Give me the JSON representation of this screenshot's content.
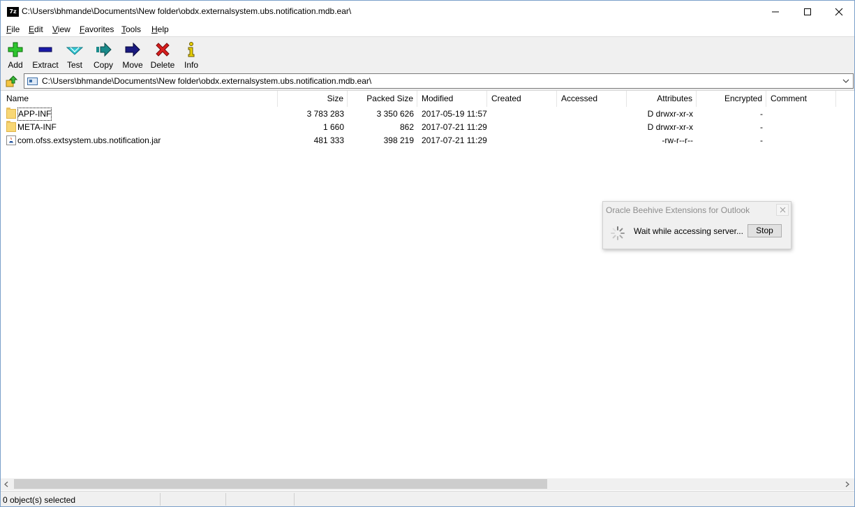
{
  "window": {
    "title": "C:\\Users\\bhmande\\Documents\\New folder\\obdx.externalsystem.ubs.notification.mdb.ear\\",
    "app_icon": "7z"
  },
  "menu": [
    {
      "label": "File",
      "key": "F",
      "rest": "ile"
    },
    {
      "label": "Edit",
      "key": "E",
      "rest": "dit"
    },
    {
      "label": "View",
      "key": "V",
      "rest": "iew"
    },
    {
      "label": "Favorites",
      "key": "F",
      "rest": "avorites"
    },
    {
      "label": "Tools",
      "key": "T",
      "rest": "ools"
    },
    {
      "label": "Help",
      "key": "H",
      "rest": "elp"
    }
  ],
  "toolbar": {
    "add": "Add",
    "extract": "Extract",
    "test": "Test",
    "copy": "Copy",
    "move": "Move",
    "delete": "Delete",
    "info": "Info"
  },
  "address": {
    "path": "C:\\Users\\bhmande\\Documents\\New folder\\obdx.externalsystem.ubs.notification.mdb.ear\\"
  },
  "columns": {
    "name": "Name",
    "size": "Size",
    "packed_size": "Packed Size",
    "modified": "Modified",
    "created": "Created",
    "accessed": "Accessed",
    "attributes": "Attributes",
    "encrypted": "Encrypted",
    "comment": "Comment"
  },
  "files": [
    {
      "name": "APP-INF",
      "type": "folder",
      "size": "3 783 283",
      "packed_size": "3 350 626",
      "modified": "2017-05-19 11:57",
      "created": "",
      "accessed": "",
      "attributes": "D drwxr-xr-x",
      "encrypted": "-",
      "comment": ""
    },
    {
      "name": "META-INF",
      "type": "folder",
      "size": "1 660",
      "packed_size": "862",
      "modified": "2017-07-21 11:29",
      "created": "",
      "accessed": "",
      "attributes": "D drwxr-xr-x",
      "encrypted": "-",
      "comment": ""
    },
    {
      "name": "com.ofss.extsystem.ubs.notification.jar",
      "type": "jar",
      "size": "481 333",
      "packed_size": "398 219",
      "modified": "2017-07-21 11:29",
      "created": "",
      "accessed": "",
      "attributes": "-rw-r--r--",
      "encrypted": "-",
      "comment": ""
    }
  ],
  "status": {
    "selection": "0 object(s) selected"
  },
  "popup": {
    "title": "Oracle Beehive Extensions for Outlook",
    "message": "Wait while accessing server...",
    "stop_label": "Stop"
  },
  "colors": {
    "toolbar_bg": "#f0f0f0",
    "add_green": "#2ec52e",
    "extract_blue": "#1a1aa8",
    "test_cyan": "#35c9d6",
    "copy_teal": "#1a8a8a",
    "move_navy": "#1a1a80",
    "delete_red": "#d81e1e",
    "info_yellow": "#e8d000"
  }
}
